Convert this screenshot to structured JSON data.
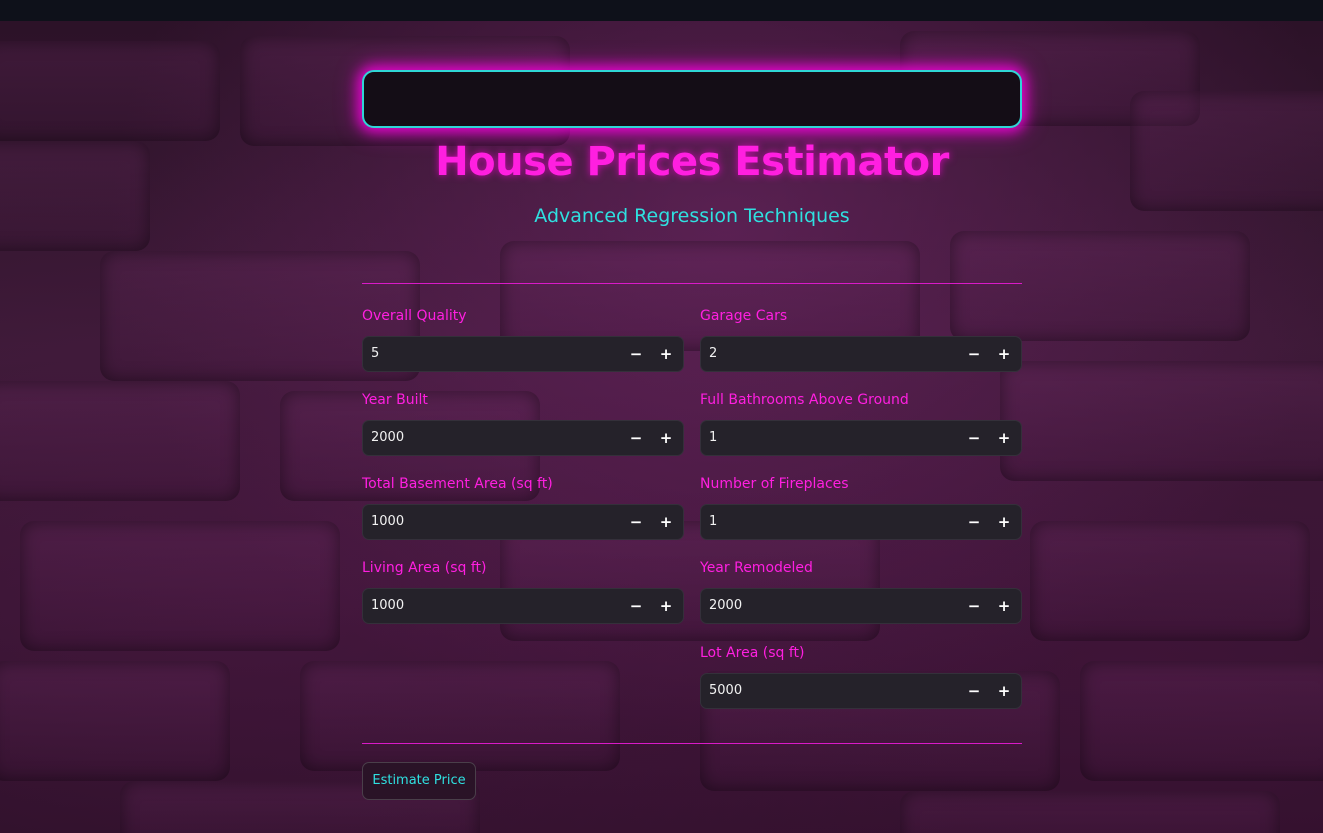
{
  "header": {
    "title": "House Prices Estimator",
    "subtitle": "Advanced Regression Techniques"
  },
  "colors": {
    "accent_magenta": "#ff1fe0",
    "accent_cyan": "#2fe0e0",
    "input_bg": "#25222a",
    "topbar": "#0e111a"
  },
  "fields_left": [
    {
      "label": "Overall Quality",
      "value": "5"
    },
    {
      "label": "Year Built",
      "value": "2000"
    },
    {
      "label": "Total Basement Area (sq ft)",
      "value": "1000"
    },
    {
      "label": "Living Area (sq ft)",
      "value": "1000"
    }
  ],
  "fields_right": [
    {
      "label": "Garage Cars",
      "value": "2"
    },
    {
      "label": "Full Bathrooms Above Ground",
      "value": "1"
    },
    {
      "label": "Number of Fireplaces",
      "value": "1"
    },
    {
      "label": "Year Remodeled",
      "value": "2000"
    },
    {
      "label": "Lot Area (sq ft)",
      "value": "5000"
    }
  ],
  "stepper": {
    "minus": "−",
    "plus": "+"
  },
  "actions": {
    "estimate_label": "Estimate Price"
  }
}
